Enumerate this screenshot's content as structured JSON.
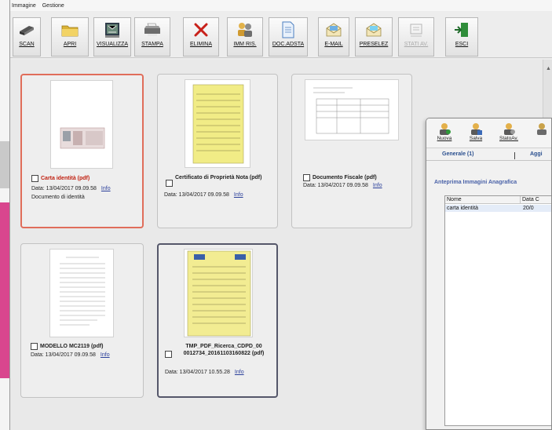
{
  "menu": [
    "Immagine",
    "Gestione"
  ],
  "toolbar": {
    "buttons": [
      {
        "label": "SCAN",
        "icon": "scanner-icon"
      },
      {
        "label": "APRI",
        "icon": "folder-icon"
      },
      {
        "label": "VISUALIZZA",
        "icon": "view-document-icon"
      },
      {
        "label": "STAMPA",
        "icon": "printer-icon"
      },
      {
        "label": "ELIMINA",
        "icon": "delete-x-icon"
      },
      {
        "label": "IMM RIS.",
        "icon": "people-icon"
      },
      {
        "label": "DOC.ADSTA",
        "icon": "document-icon"
      },
      {
        "label": "E-MAIL",
        "icon": "envelope-icon"
      },
      {
        "label": "PRESELEZ",
        "icon": "envelope-select-icon"
      },
      {
        "label": "STATI AV.",
        "icon": "status-icon"
      },
      {
        "label": "ESCI",
        "icon": "exit-door-icon"
      }
    ]
  },
  "documents": [
    {
      "title": "Carta identità (pdf)",
      "date": "Data: 13/04/2017 09.09.58",
      "info": "Info",
      "description": "Documento di identità"
    },
    {
      "title": "Certificato di Proprietà Nota (pdf)",
      "date": "Data: 13/04/2017 09.09.58",
      "info": "Info"
    },
    {
      "title": "Documento Fiscale (pdf)",
      "date": "Data: 13/04/2017 09.09.58",
      "info": "Info"
    },
    {
      "title": "MODELLO MC2119 (pdf)",
      "date": "Data: 13/04/2017 09.09.58",
      "info": "Info"
    },
    {
      "title": "TMP_PDF_Ricerca_CDPD_00 0012734_20161103160822 (pdf)",
      "date": "Data: 13/04/2017 10.55.28",
      "info": "Info"
    }
  ],
  "anagrafica": {
    "buttons": [
      {
        "label": "Nuova",
        "icon": "user-new-icon"
      },
      {
        "label": "Salva",
        "icon": "user-save-icon"
      },
      {
        "label": "StatoAv.",
        "icon": "user-status-icon"
      }
    ],
    "tabs": [
      "Generale (1)",
      "Aggi"
    ],
    "heading": "Anteprima Immagini Anagrafica",
    "columns": [
      "Nome",
      "Data C"
    ],
    "rows": [
      {
        "nome": "carta identità",
        "data": "20/0"
      }
    ]
  }
}
